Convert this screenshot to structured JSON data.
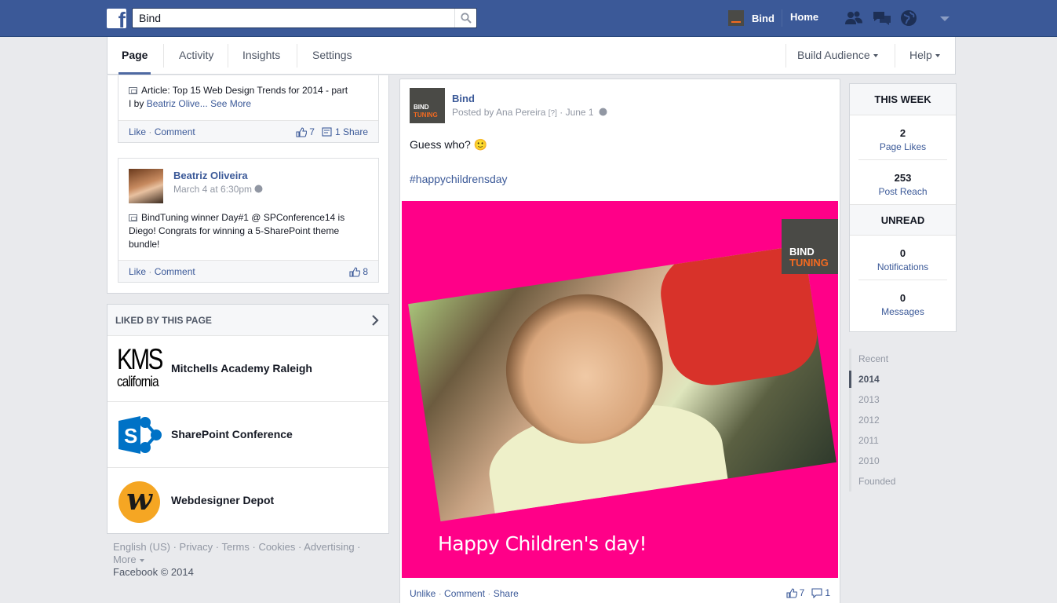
{
  "topbar": {
    "logo": "f",
    "search_value": "Bind",
    "search_icon": "search-icon",
    "user_name": "Bind",
    "home": "Home",
    "icons": [
      "friend-requests-icon",
      "messages-icon",
      "notifications-globe-icon",
      "account-menu-caret-icon"
    ],
    "colors": {
      "bar": "#3b5998",
      "accent_orange": "#f26a21"
    }
  },
  "pagenav": {
    "tabs": [
      "Page",
      "Activity",
      "Insights",
      "Settings"
    ],
    "active_tab": "Page",
    "build_audience": "Build Audience",
    "help": "Help"
  },
  "left_posts": [
    {
      "text_line1": "Article: Top 15 Web Design Trends for 2014 - part",
      "text_line2_prefix": "I by ",
      "text_author": "Beatriz Olive...",
      "see_more": "See More",
      "like": "Like",
      "comment": "Comment",
      "likes": "7",
      "shares": "1 Share"
    },
    {
      "author": "Beatriz Oliveira",
      "time": "March 4 at 6:30pm",
      "text_line1": "BindTuning winner Day#1 @ SPConference14 is",
      "text_line2": "Diego! Congrats for winning a 5-SharePoint theme",
      "text_line3": "bundle!",
      "like": "Like",
      "comment": "Comment",
      "likes": "8"
    }
  ],
  "liked_by_page": {
    "heading": "LIKED BY THIS PAGE",
    "items": [
      {
        "name": "Mitchells Academy Raleigh",
        "logo_line1": "KMS",
        "logo_line2": "california"
      },
      {
        "name": "SharePoint Conference",
        "logo_letter": "S"
      },
      {
        "name": "Webdesigner Depot",
        "logo_letter": "w"
      }
    ]
  },
  "footer": {
    "links": [
      "English (US)",
      "Privacy",
      "Terms",
      "Cookies",
      "Advertising",
      "More"
    ],
    "copyright": "Facebook © 2014"
  },
  "post": {
    "page_name": "Bind",
    "avatar_line1": "BIND",
    "avatar_line2": "TUNING",
    "posted_by_prefix": "Posted by ",
    "posted_by": "Ana Pereira",
    "help_mark": "[?]",
    "date": "June 1",
    "text": "Guess who? 🙂",
    "hashtag": "#happychildrensday",
    "image_badge_line1": "BIND",
    "image_badge_line2": "TUNING",
    "image_caption": "Happy Children's day!",
    "image_bg": "#ff0088",
    "actions": [
      "Unlike",
      "Comment",
      "Share"
    ],
    "likes": "7",
    "comments": "1"
  },
  "this_week": {
    "heading": "THIS WEEK",
    "stats": [
      {
        "value": "2",
        "label": "Page Likes"
      },
      {
        "value": "253",
        "label": "Post Reach"
      }
    ]
  },
  "unread": {
    "heading": "UNREAD",
    "stats": [
      {
        "value": "0",
        "label": "Notifications"
      },
      {
        "value": "0",
        "label": "Messages"
      }
    ]
  },
  "timeline": {
    "items": [
      "Recent",
      "2014",
      "2013",
      "2012",
      "2011",
      "2010",
      "Founded"
    ],
    "selected": "2014"
  }
}
